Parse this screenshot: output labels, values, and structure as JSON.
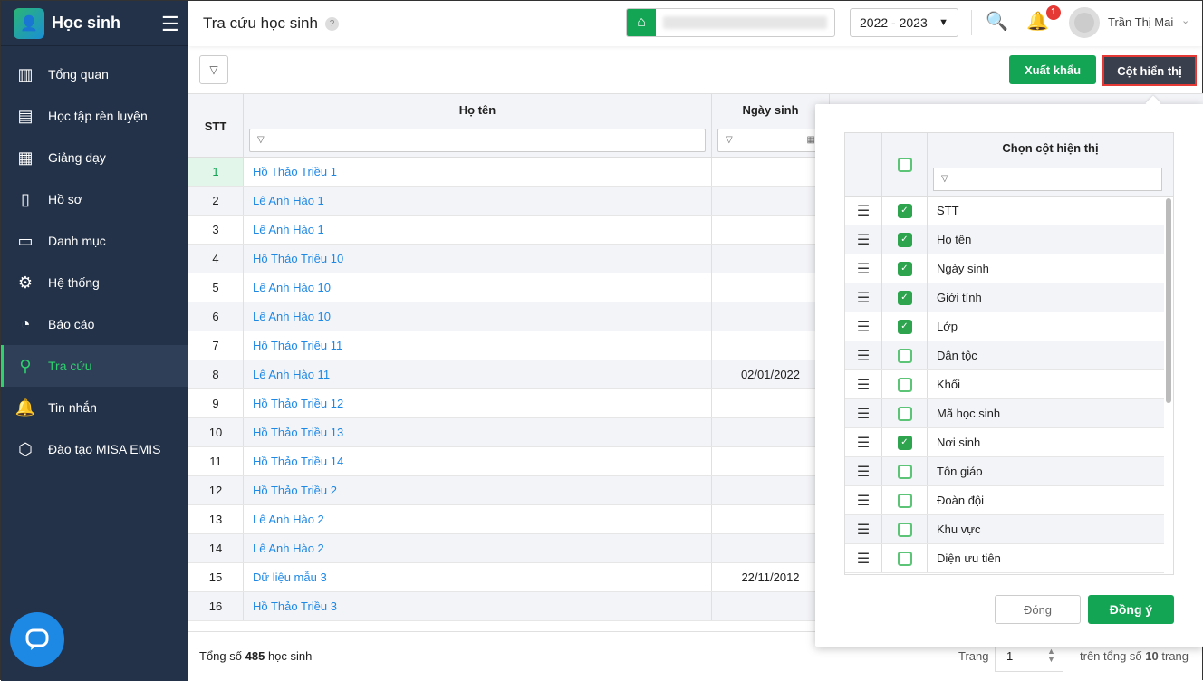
{
  "sidebar": {
    "title": "Học sinh",
    "items": [
      {
        "label": "Tổng quan",
        "icon": "bar-chart-icon",
        "glyph": "▥"
      },
      {
        "label": "Học tập rèn luyện",
        "icon": "book-icon",
        "glyph": "▤"
      },
      {
        "label": "Giảng dạy",
        "icon": "board-icon",
        "glyph": "▦"
      },
      {
        "label": "Hồ sơ",
        "icon": "document-icon",
        "glyph": "▯"
      },
      {
        "label": "Danh mục",
        "icon": "folder-icon",
        "glyph": "▭"
      },
      {
        "label": "Hệ thống",
        "icon": "gear-icon",
        "glyph": "⚙"
      },
      {
        "label": "Báo cáo",
        "icon": "pie-chart-icon",
        "glyph": "◔"
      },
      {
        "label": "Tra cứu",
        "icon": "search-icon",
        "glyph": "⚲",
        "active": true
      },
      {
        "label": "Tin nhắn",
        "icon": "bell-icon",
        "glyph": "🔔"
      },
      {
        "label": "Đào tạo MISA EMIS",
        "icon": "cube-icon",
        "glyph": "⬡"
      }
    ]
  },
  "header": {
    "title": "Tra cứu học sinh",
    "help": "?",
    "school_year": "2022 - 2023",
    "notification_count": "1",
    "user_name": "Trần Thị Mai"
  },
  "toolbar": {
    "export_label": "Xuất khẩu",
    "columns_label": "Cột hiển thị"
  },
  "table": {
    "headers": {
      "stt": "STT",
      "name": "Họ tên",
      "dob": "Ngày sinh"
    },
    "rows": [
      {
        "stt": "1",
        "name": "Hồ Thảo Triều 1",
        "dob": ""
      },
      {
        "stt": "2",
        "name": "Lê Anh Hào 1",
        "dob": ""
      },
      {
        "stt": "3",
        "name": "Lê Anh Hào 1",
        "dob": ""
      },
      {
        "stt": "4",
        "name": "Hồ Thảo Triều 10",
        "dob": ""
      },
      {
        "stt": "5",
        "name": "Lê Anh Hào 10",
        "dob": ""
      },
      {
        "stt": "6",
        "name": "Lê Anh Hào 10",
        "dob": ""
      },
      {
        "stt": "7",
        "name": "Hồ Thảo Triều 11",
        "dob": ""
      },
      {
        "stt": "8",
        "name": "Lê Anh Hào 11",
        "dob": "02/01/2022"
      },
      {
        "stt": "9",
        "name": "Hồ Thảo Triều 12",
        "dob": ""
      },
      {
        "stt": "10",
        "name": "Hồ Thảo Triều 13",
        "dob": ""
      },
      {
        "stt": "11",
        "name": "Hồ Thảo Triều 14",
        "dob": ""
      },
      {
        "stt": "12",
        "name": "Hồ Thảo Triều 2",
        "dob": ""
      },
      {
        "stt": "13",
        "name": "Lê Anh Hào 2",
        "dob": ""
      },
      {
        "stt": "14",
        "name": "Lê Anh Hào 2",
        "dob": ""
      },
      {
        "stt": "15",
        "name": "Dữ liệu mẫu 3",
        "dob": "22/11/2012"
      },
      {
        "stt": "16",
        "name": "Hồ Thảo Triều 3",
        "dob": ""
      }
    ]
  },
  "footer": {
    "total_prefix": "Tổng số",
    "total": "485",
    "total_suffix": "học sinh",
    "page_label": "Trang",
    "page": "1",
    "pages_prefix": "trên tổng số",
    "pages": "10",
    "pages_suffix": "trang"
  },
  "column_picker": {
    "title": "Chọn cột hiện thị",
    "columns": [
      {
        "label": "STT",
        "checked": true
      },
      {
        "label": "Họ tên",
        "checked": true
      },
      {
        "label": "Ngày sinh",
        "checked": true
      },
      {
        "label": "Giới tính",
        "checked": true
      },
      {
        "label": "Lớp",
        "checked": true
      },
      {
        "label": "Dân tộc",
        "checked": false
      },
      {
        "label": "Khối",
        "checked": false
      },
      {
        "label": "Mã học sinh",
        "checked": false
      },
      {
        "label": "Nơi sinh",
        "checked": true
      },
      {
        "label": "Tôn giáo",
        "checked": false
      },
      {
        "label": "Đoàn đội",
        "checked": false
      },
      {
        "label": "Khu vực",
        "checked": false
      },
      {
        "label": "Diện ưu tiên",
        "checked": false
      }
    ],
    "close_label": "Đóng",
    "ok_label": "Đồng ý"
  },
  "colors": {
    "accent": "#13a454",
    "sidebar": "#233248",
    "link": "#1e88e5"
  }
}
